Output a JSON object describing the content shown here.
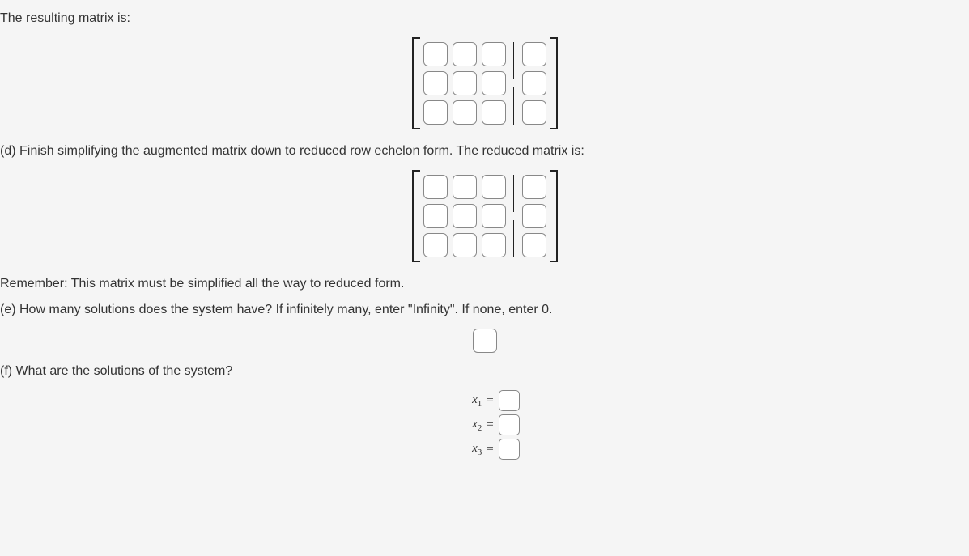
{
  "intro_text": "The resulting matrix is:",
  "part_d": "(d) Finish simplifying the augmented matrix down to reduced row echelon form. The reduced matrix is:",
  "remember_text": "Remember: This matrix must be simplified all the way to reduced form.",
  "part_e": "(e) How many solutions does the system have? If infinitely many, enter \"Infinity\". If none, enter 0.",
  "part_f": "(f) What are the solutions of the system?",
  "matrix1": {
    "rows": 3,
    "cols": 3,
    "aug_cols": 1,
    "values": [
      [
        "",
        "",
        ""
      ],
      [
        "",
        "",
        ""
      ],
      [
        "",
        "",
        ""
      ]
    ],
    "aug_values": [
      [
        ""
      ],
      [
        ""
      ],
      [
        ""
      ]
    ]
  },
  "matrix2": {
    "rows": 3,
    "cols": 3,
    "aug_cols": 1,
    "values": [
      [
        "",
        "",
        ""
      ],
      [
        "",
        "",
        ""
      ],
      [
        "",
        "",
        ""
      ]
    ],
    "aug_values": [
      [
        ""
      ],
      [
        ""
      ],
      [
        ""
      ]
    ]
  },
  "solutions_count": "",
  "solutions": {
    "x1": {
      "var": "x",
      "sub": "1",
      "value": ""
    },
    "x2": {
      "var": "x",
      "sub": "2",
      "value": ""
    },
    "x3": {
      "var": "x",
      "sub": "3",
      "value": ""
    }
  },
  "eq": "="
}
